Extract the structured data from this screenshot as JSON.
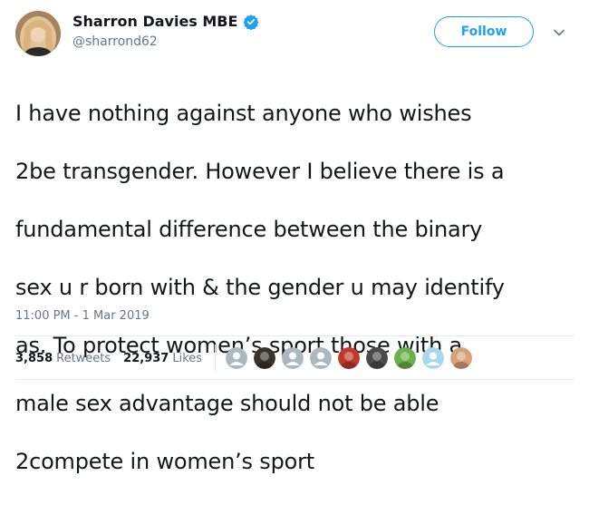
{
  "author": {
    "display_name": "Sharron Davies MBE",
    "handle": "@sharrond62",
    "verified_icon": "verified-badge-icon",
    "avatar_icon": "profile-photo"
  },
  "follow_button": {
    "label": "Follow"
  },
  "menu": {
    "icon": "chevron-down-icon"
  },
  "tweet": {
    "text_lines": [
      "I have nothing against anyone who wishes",
      "2be transgender. However I believe there is a",
      "fundamental difference between the binary",
      "sex u r born with & the gender u may identify",
      "as. To protect women’s sport those with a",
      "male sex advantage should not be able",
      "2compete in women’s sport"
    ],
    "timestamp": "11:00 PM - 1 Mar 2019"
  },
  "stats": {
    "retweets_count": "3,858",
    "retweets_label": "Retweets",
    "likes_count": "22,937",
    "likes_label": "Likes"
  },
  "likers": [
    {
      "kind": "default-avatar",
      "color": "#aab8c2"
    },
    {
      "kind": "photo-avatar",
      "color": "#3b3228"
    },
    {
      "kind": "default-avatar",
      "color": "#aab8c2"
    },
    {
      "kind": "default-avatar",
      "color": "#aab8c2"
    },
    {
      "kind": "photo-avatar",
      "color": "#c0392b"
    },
    {
      "kind": "photo-avatar",
      "color": "#4a4a4a"
    },
    {
      "kind": "photo-avatar",
      "color": "#6ab04c"
    },
    {
      "kind": "default-avatar",
      "color": "#a7d8f0"
    },
    {
      "kind": "photo-avatar",
      "color": "#d7a17a"
    }
  ],
  "colors": {
    "accent": "#1da1f2",
    "text": "#14171a",
    "secondary_text": "#657786",
    "divider": "#e6ecf0"
  }
}
